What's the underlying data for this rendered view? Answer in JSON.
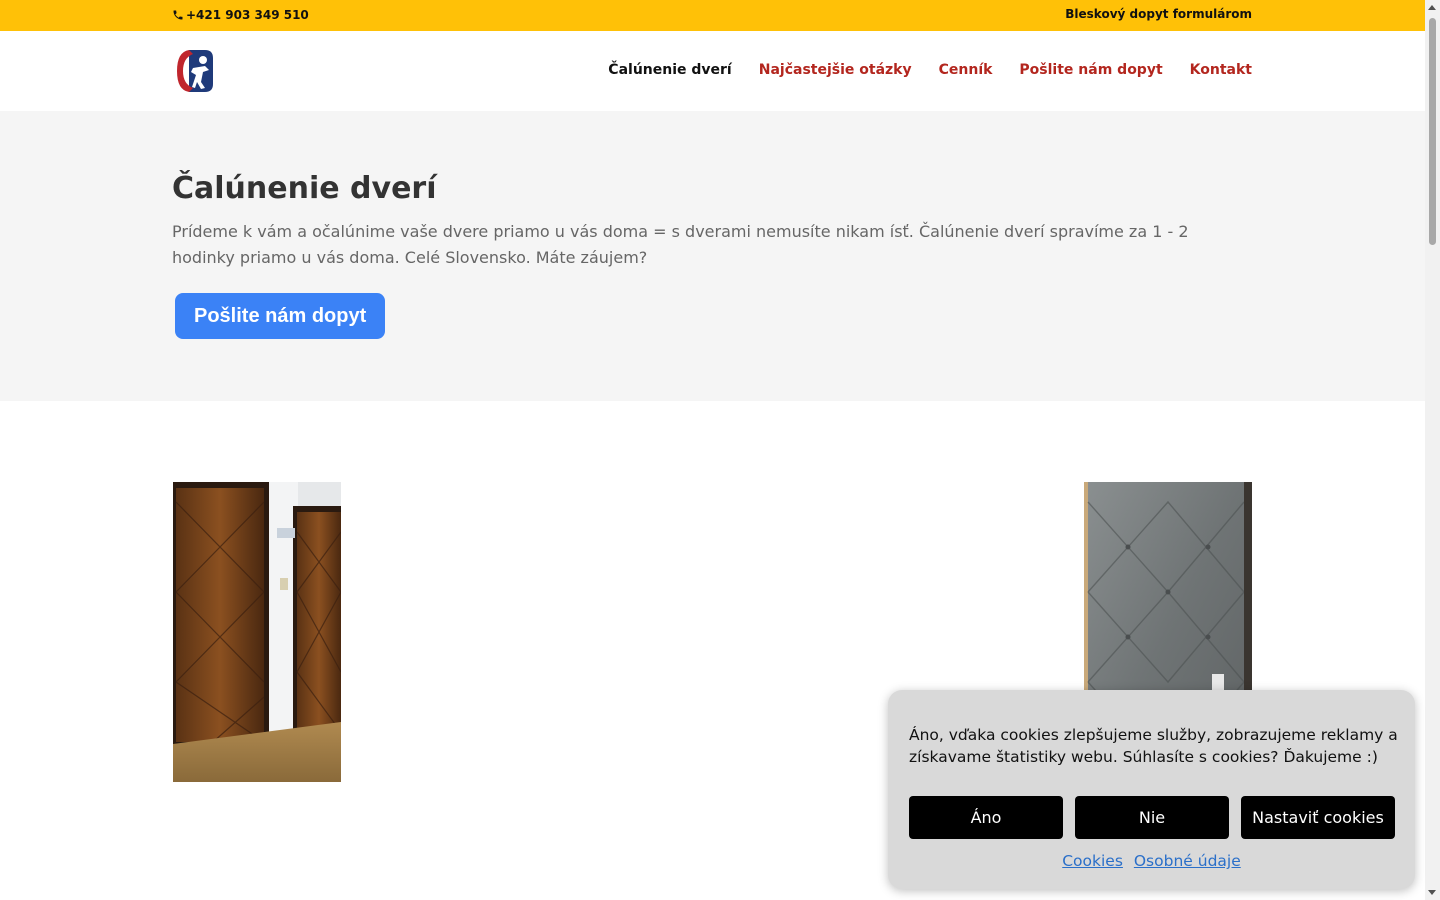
{
  "topbar": {
    "phone": "+421 903 349 510",
    "quick_link": "Bleskový dopyt formulárom",
    "background": "#ffc107"
  },
  "nav": {
    "items": [
      {
        "label": "Čalúnenie dverí",
        "active": true
      },
      {
        "label": "Najčastejšie otázky",
        "active": false
      },
      {
        "label": "Cenník",
        "active": false
      },
      {
        "label": "Pošlite nám dopyt",
        "active": false
      },
      {
        "label": "Kontakt",
        "active": false
      }
    ],
    "link_color": "#b3261e",
    "active_color": "#111111"
  },
  "hero": {
    "title": "Čalúnenie dverí",
    "text": "Prídeme k vám a očalúnime vaše dvere priamo u vás doma = s dverami nemusíte nikam ísť. Čalúnenie dverí spravíme za 1 - 2 hodinky priamo u vás doma. Celé Slovensko. Máte záujem?",
    "cta": "Pošlite nám dopyt",
    "cta_color": "#3b82f6"
  },
  "cookie": {
    "message": "Áno, vďaka cookies zlepšujeme služby, zobrazujeme reklamy a získavame štatistiky webu. Súhlasíte s cookies? Ďakujeme :)",
    "accept": "Áno",
    "reject": "Nie",
    "settings": "Nastaviť cookies",
    "link_cookies": "Cookies",
    "link_personal": "Osobné údaje"
  },
  "icons": {
    "phone": "phone-icon",
    "logo": "brand-logo-icon"
  }
}
